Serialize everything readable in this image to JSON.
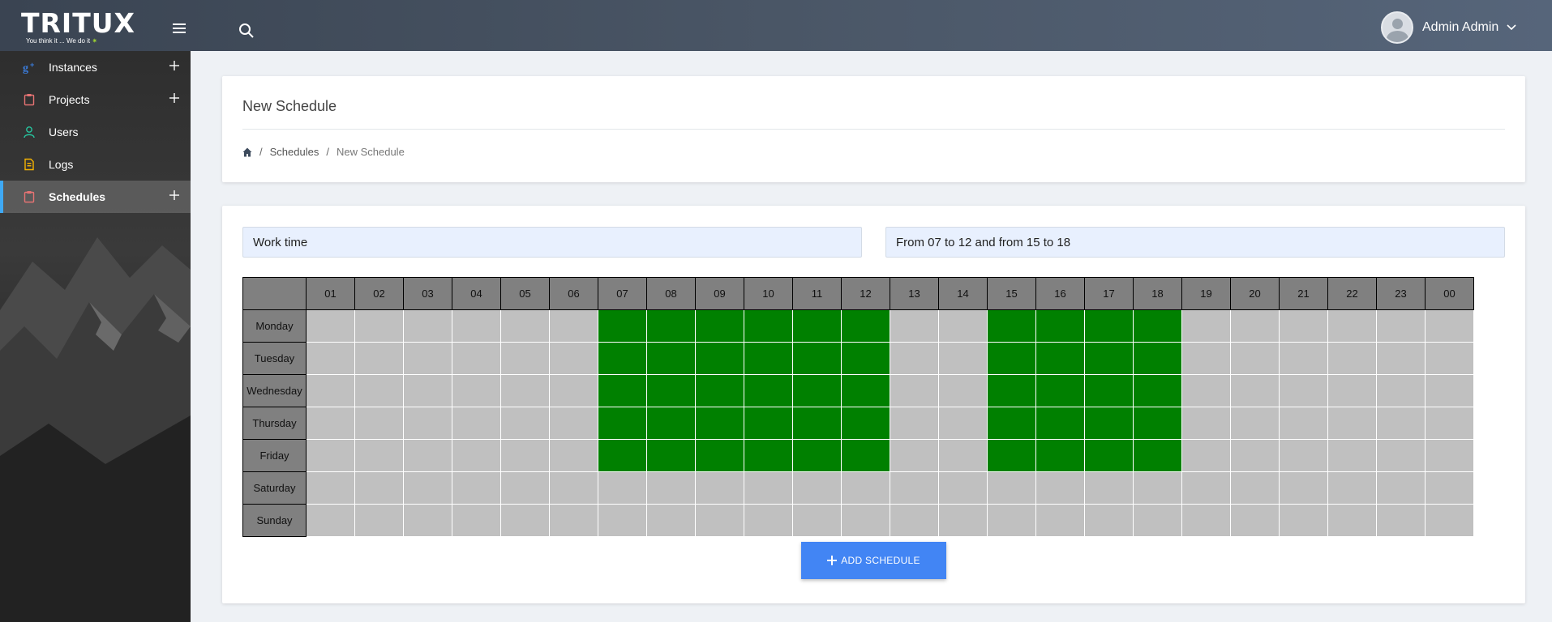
{
  "brand": {
    "name": "TRITUX",
    "tagline": "You think it ... We do it",
    "tagline_star": "✷"
  },
  "header": {
    "user_name": "Admin Admin"
  },
  "sidebar": {
    "items": [
      {
        "label": "Instances",
        "icon": "google-plus-icon",
        "color": "#3b7ddd",
        "expandable": true,
        "active": false
      },
      {
        "label": "Projects",
        "icon": "clipboard-icon",
        "color": "#e57373",
        "expandable": true,
        "active": false
      },
      {
        "label": "Users",
        "icon": "user-icon",
        "color": "#26c6a0",
        "expandable": false,
        "active": false
      },
      {
        "label": "Logs",
        "icon": "file-icon",
        "color": "#f5b301",
        "expandable": false,
        "active": false
      },
      {
        "label": "Schedules",
        "icon": "clipboard-icon",
        "color": "#e57373",
        "expandable": true,
        "active": true
      }
    ]
  },
  "page": {
    "title": "New Schedule"
  },
  "breadcrumb": {
    "separator": "/",
    "schedules": "Schedules",
    "current": "New Schedule"
  },
  "form": {
    "name_value": "Work time",
    "description_value": "From 07 to 12 and from 15 to 18"
  },
  "schedule": {
    "hours": [
      "01",
      "02",
      "03",
      "04",
      "05",
      "06",
      "07",
      "08",
      "09",
      "10",
      "11",
      "12",
      "13",
      "14",
      "15",
      "16",
      "17",
      "18",
      "19",
      "20",
      "21",
      "22",
      "23",
      "00"
    ],
    "days": [
      "Monday",
      "Tuesday",
      "Wednesday",
      "Thursday",
      "Friday",
      "Saturday",
      "Sunday"
    ],
    "active_hours": {
      "Monday": [
        "07",
        "08",
        "09",
        "10",
        "11",
        "12",
        "15",
        "16",
        "17",
        "18"
      ],
      "Tuesday": [
        "07",
        "08",
        "09",
        "10",
        "11",
        "12",
        "15",
        "16",
        "17",
        "18"
      ],
      "Wednesday": [
        "07",
        "08",
        "09",
        "10",
        "11",
        "12",
        "15",
        "16",
        "17",
        "18"
      ],
      "Thursday": [
        "07",
        "08",
        "09",
        "10",
        "11",
        "12",
        "15",
        "16",
        "17",
        "18"
      ],
      "Friday": [
        "07",
        "08",
        "09",
        "10",
        "11",
        "12",
        "15",
        "16",
        "17",
        "18"
      ],
      "Saturday": [],
      "Sunday": []
    },
    "colors": {
      "active": "#008000",
      "inactive": "#c0c0c0",
      "header": "#808080"
    }
  },
  "actions": {
    "add_label": "ADD SCHEDULE"
  },
  "colors": {
    "accent": "#4285f4",
    "active_nav_border": "#3fa9f5"
  }
}
